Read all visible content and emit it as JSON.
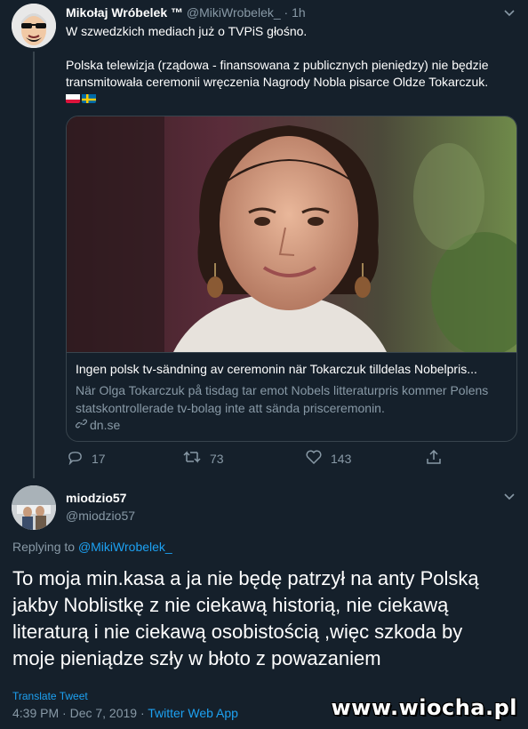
{
  "tweet": {
    "author_name": "Mikołaj Wróbelek ™",
    "author_handle": "@MikiWrobelek_",
    "separator": "·",
    "age": "1h",
    "text_line1": "W szwedzkich mediach już o TVPiS głośno.",
    "text_line2": "Polska telewizja (rządowa - finansowana z publicznych pieniędzy) nie będzie transmitowała ceremonii wręczenia Nagrody Nobla pisarce Oldze Tokarczuk.",
    "flags": [
      "poland-flag-icon",
      "sweden-flag-icon"
    ],
    "card": {
      "title": "Ingen polsk tv-sändning av ceremonin när Tokarczuk tilldelas Nobelpris...",
      "description": "När Olga Tokarczuk på tisdag tar emot Nobels litteraturpris kommer Polens statskontrollerade tv-bolag inte att sända prisceremonin.",
      "domain": "dn.se"
    },
    "actions": {
      "replies": "17",
      "retweets": "73",
      "likes": "143"
    }
  },
  "reply": {
    "author_name": "miodzio57",
    "author_handle": "@miodzio57",
    "replying_to_label": "Replying to",
    "replying_to_handle": "@MikiWrobelek_",
    "text": "To moja min.kasa a ja nie będę patrzył na anty Polską jakby Noblistkę z nie ciekawą historią, nie ciekawą literaturą i nie ciekawą osobistością ,więc szkoda by moje pieniądze szły w błoto z powazaniem",
    "translate_label": "Translate Tweet",
    "timestamp": "4:39 PM · Dec 7, 2019 · ",
    "source_app": "Twitter Web App"
  },
  "watermark": "www.wiocha.pl",
  "colors": {
    "background": "#15202b",
    "border": "#38444d",
    "muted": "#8899a6",
    "link": "#1da1f2"
  }
}
